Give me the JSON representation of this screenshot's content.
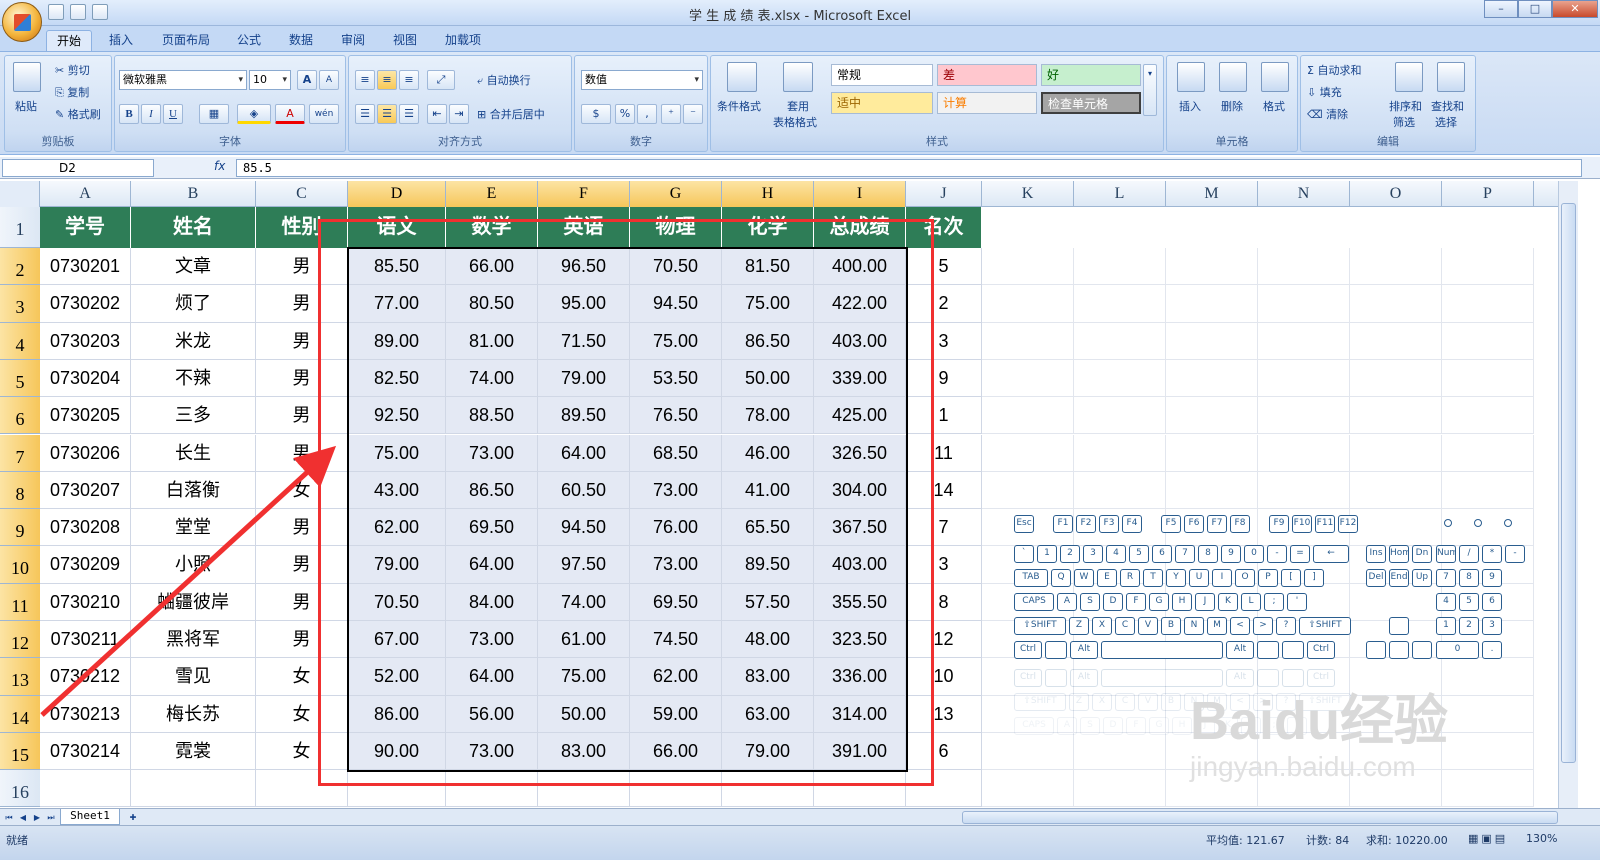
{
  "window": {
    "title": "学 生 成 绩 表.xlsx - Microsoft Excel",
    "min": "–",
    "max": "□",
    "close": "✕"
  },
  "tabs": [
    "开始",
    "插入",
    "页面布局",
    "公式",
    "数据",
    "审阅",
    "视图",
    "加载项"
  ],
  "ribbon": {
    "clipboard": {
      "paste": "粘贴",
      "cut": "剪切",
      "copy": "复制",
      "format_painter": "格式刷",
      "label": "剪贴板"
    },
    "font": {
      "name": "微软雅黑",
      "size": "10",
      "grow": "A",
      "shrink": "A",
      "bold": "B",
      "italic": "I",
      "underline": "U",
      "font_color": "A",
      "phonetic": "wén",
      "label": "字体"
    },
    "alignment": {
      "wrap": "自动换行",
      "merge": "合并后居中",
      "label": "对齐方式"
    },
    "number": {
      "format": "数值",
      "percent": "%",
      "comma": ",",
      "label": "数字"
    },
    "styles": {
      "conditional": "条件格式",
      "table_format_1": "套用",
      "table_format_2": "表格格式",
      "label": "样式",
      "cells": [
        {
          "text": "常规",
          "bg": "#ffffff",
          "fg": "#000000"
        },
        {
          "text": "差",
          "bg": "#ffc7ce",
          "fg": "#9c0006"
        },
        {
          "text": "好",
          "bg": "#c6efce",
          "fg": "#006100"
        },
        {
          "text": "适中",
          "bg": "#ffeb9c",
          "fg": "#9c6500"
        },
        {
          "text": "计算",
          "bg": "#f2f2f2",
          "fg": "#fa7d00"
        },
        {
          "text": "检查单元格",
          "bg": "#a5a5a5",
          "fg": "#ffffff"
        }
      ]
    },
    "cells_group": {
      "insert": "插入",
      "delete": "删除",
      "format": "格式",
      "label": "单元格"
    },
    "editing": {
      "autosum": "自动求和",
      "fill": "填充",
      "clear": "清除",
      "sort_1": "排序和",
      "sort_2": "筛选",
      "find_1": "查找和",
      "find_2": "选择",
      "label": "编辑"
    }
  },
  "formula_bar": {
    "name_box": "D2",
    "fx": "fx",
    "value": "85.5"
  },
  "columns": [
    "A",
    "B",
    "C",
    "D",
    "E",
    "F",
    "G",
    "H",
    "I",
    "J",
    "K",
    "L",
    "M",
    "N",
    "O",
    "P"
  ],
  "selected_columns": [
    "D",
    "E",
    "F",
    "G",
    "H",
    "I"
  ],
  "table": {
    "headers": [
      "学号",
      "姓名",
      "性别",
      "语文",
      "数学",
      "英语",
      "物理",
      "化学",
      "总成绩",
      "名次"
    ],
    "rows": [
      [
        "0730201",
        "文章",
        "男",
        "85.50",
        "66.00",
        "96.50",
        "70.50",
        "81.50",
        "400.00",
        "5"
      ],
      [
        "0730202",
        "烦了",
        "男",
        "77.00",
        "80.50",
        "95.00",
        "94.50",
        "75.00",
        "422.00",
        "2"
      ],
      [
        "0730203",
        "米龙",
        "男",
        "89.00",
        "81.00",
        "71.50",
        "75.00",
        "86.50",
        "403.00",
        "3"
      ],
      [
        "0730204",
        "不辣",
        "男",
        "82.50",
        "74.00",
        "79.00",
        "53.50",
        "50.00",
        "339.00",
        "9"
      ],
      [
        "0730205",
        "三多",
        "男",
        "92.50",
        "88.50",
        "89.50",
        "76.50",
        "78.00",
        "425.00",
        "1"
      ],
      [
        "0730206",
        "长生",
        "男",
        "75.00",
        "73.00",
        "64.00",
        "68.50",
        "46.00",
        "326.50",
        "11"
      ],
      [
        "0730207",
        "白落衡",
        "女",
        "43.00",
        "86.50",
        "60.50",
        "73.00",
        "41.00",
        "304.00",
        "14"
      ],
      [
        "0730208",
        "堂堂",
        "男",
        "62.00",
        "69.50",
        "94.50",
        "76.00",
        "65.50",
        "367.50",
        "7"
      ],
      [
        "0730209",
        "小照",
        "男",
        "79.00",
        "64.00",
        "97.50",
        "73.00",
        "89.50",
        "403.00",
        "3"
      ],
      [
        "0730210",
        "蛐疆彼岸",
        "男",
        "70.50",
        "84.00",
        "74.00",
        "69.50",
        "57.50",
        "355.50",
        "8"
      ],
      [
        "0730211",
        "黑将军",
        "男",
        "67.00",
        "73.00",
        "61.00",
        "74.50",
        "48.00",
        "323.50",
        "12"
      ],
      [
        "0730212",
        "雪见",
        "女",
        "52.00",
        "64.00",
        "75.00",
        "62.00",
        "83.00",
        "336.00",
        "10"
      ],
      [
        "0730213",
        "梅长苏",
        "女",
        "86.00",
        "56.00",
        "50.00",
        "59.00",
        "63.00",
        "314.00",
        "13"
      ],
      [
        "0730214",
        "霓裳",
        "女",
        "90.00",
        "73.00",
        "83.00",
        "66.00",
        "79.00",
        "391.00",
        "6"
      ]
    ]
  },
  "row_numbers": [
    "1",
    "2",
    "3",
    "4",
    "5",
    "6",
    "7",
    "8",
    "9",
    "10",
    "11",
    "12",
    "13",
    "14",
    "15",
    "16"
  ],
  "keyboard": {
    "fn_keys": [
      "Esc",
      "F1",
      "F2",
      "F3",
      "F4",
      "F5",
      "F6",
      "F7",
      "F8",
      "F9",
      "F10",
      "F11",
      "F12"
    ],
    "number_row": [
      "`",
      "1",
      "2",
      "3",
      "4",
      "5",
      "6",
      "7",
      "8",
      "9",
      "0",
      "-",
      "=",
      "←"
    ],
    "tab_row": [
      "TAB",
      "Q",
      "W",
      "E",
      "R",
      "T",
      "Y",
      "U",
      "I",
      "O",
      "P",
      "[",
      "]"
    ],
    "caps_row": [
      "CAPS",
      "A",
      "S",
      "D",
      "F",
      "G",
      "H",
      "J",
      "K",
      "L",
      ";",
      "'"
    ],
    "shift_row": [
      "⇧SHIFT",
      "Z",
      "X",
      "C",
      "V",
      "B",
      "N",
      "M",
      "<",
      ">",
      "?",
      "⇧SHIFT"
    ],
    "ctrl_row": [
      "Ctrl",
      "",
      "Alt",
      "",
      "Alt",
      "",
      "",
      "Ctrl"
    ],
    "nav_keys": [
      "Ins",
      "Hom",
      "Dn",
      "Del",
      "End",
      "Up"
    ],
    "numpad": [
      "Num",
      "/",
      "*",
      "-",
      "7",
      "8",
      "9",
      "4",
      "5",
      "6",
      "1",
      "2",
      "3",
      "0",
      "."
    ]
  },
  "watermark": {
    "brand": "Baidu",
    "cn": "经验",
    "url": "jingyan.baidu.com"
  },
  "sheet": {
    "tab": "Sheet1"
  },
  "status": {
    "ready": "就绪",
    "average": "平均值: 121.67",
    "count": "计数: 84",
    "sum": "求和: 10220.00",
    "zoom": "130%"
  },
  "colors": {
    "header_green": "#2e7d57",
    "selection_fill": "#e4e9f4",
    "annotation_red": "#f03030",
    "keyboard_blue": "#2a5d8f"
  }
}
